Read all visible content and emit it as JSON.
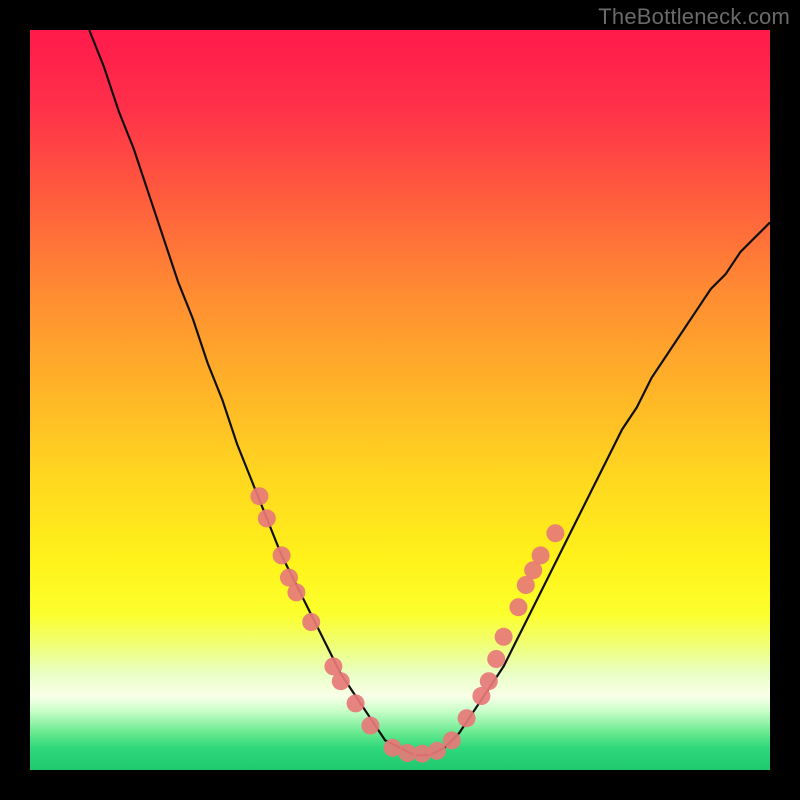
{
  "watermark": "TheBottleneck.com",
  "colors": {
    "frame": "#000000",
    "curve_stroke": "#111111",
    "dot_fill": "#e77a78",
    "gradient_top": "#ff1a4b",
    "gradient_bottom": "#1fc96f"
  },
  "chart_data": {
    "type": "line",
    "title": "",
    "xlabel": "",
    "ylabel": "",
    "xlim": [
      0,
      100
    ],
    "ylim": [
      0,
      100
    ],
    "series": [
      {
        "name": "bottleneck-curve",
        "x": [
          8,
          10,
          12,
          14,
          16,
          18,
          20,
          22,
          24,
          26,
          28,
          30,
          32,
          34,
          36,
          38,
          40,
          42,
          44,
          46,
          48,
          50,
          52,
          54,
          56,
          58,
          60,
          62,
          64,
          66,
          68,
          70,
          72,
          74,
          76,
          78,
          80,
          82,
          84,
          86,
          88,
          90,
          92,
          94,
          96,
          98,
          100
        ],
        "y": [
          100,
          95,
          89,
          84,
          78,
          72,
          66,
          61,
          55,
          50,
          44,
          39,
          34,
          29,
          25,
          21,
          17,
          13,
          10,
          7,
          4,
          3,
          2,
          2,
          3,
          5,
          8,
          11,
          14,
          18,
          22,
          26,
          30,
          34,
          38,
          42,
          46,
          49,
          53,
          56,
          59,
          62,
          65,
          67,
          70,
          72,
          74
        ]
      }
    ],
    "dots": [
      {
        "x": 31,
        "y": 37
      },
      {
        "x": 32,
        "y": 34
      },
      {
        "x": 34,
        "y": 29
      },
      {
        "x": 35,
        "y": 26
      },
      {
        "x": 36,
        "y": 24
      },
      {
        "x": 38,
        "y": 20
      },
      {
        "x": 41,
        "y": 14
      },
      {
        "x": 42,
        "y": 12
      },
      {
        "x": 44,
        "y": 9
      },
      {
        "x": 46,
        "y": 6
      },
      {
        "x": 49,
        "y": 3
      },
      {
        "x": 51,
        "y": 2.3
      },
      {
        "x": 53,
        "y": 2.2
      },
      {
        "x": 55,
        "y": 2.6
      },
      {
        "x": 57,
        "y": 4
      },
      {
        "x": 59,
        "y": 7
      },
      {
        "x": 61,
        "y": 10
      },
      {
        "x": 62,
        "y": 12
      },
      {
        "x": 63,
        "y": 15
      },
      {
        "x": 64,
        "y": 18
      },
      {
        "x": 66,
        "y": 22
      },
      {
        "x": 67,
        "y": 25
      },
      {
        "x": 68,
        "y": 27
      },
      {
        "x": 69,
        "y": 29
      },
      {
        "x": 71,
        "y": 32
      }
    ]
  }
}
